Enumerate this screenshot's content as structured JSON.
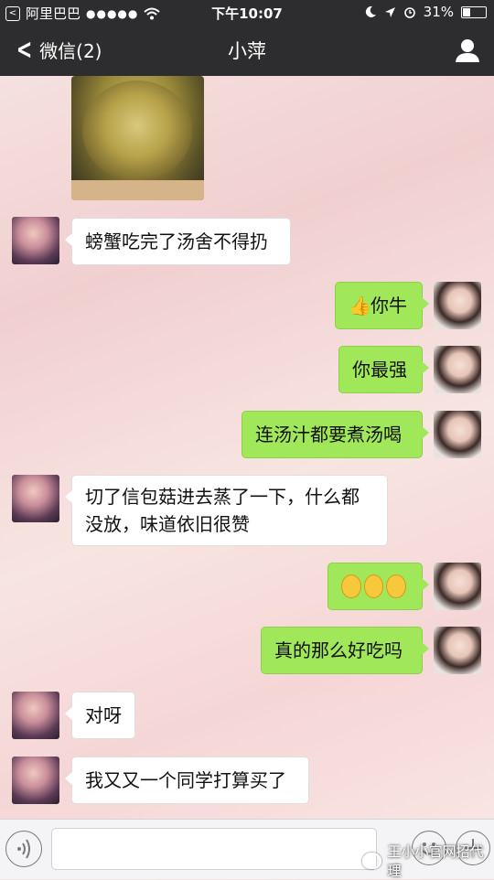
{
  "status_bar": {
    "carrier": "阿里巴巴",
    "signal_dots": "●●●●●",
    "time": "下午10:07",
    "battery_percent": "31%",
    "battery_level": 0.31
  },
  "nav": {
    "back_label": "微信(2)",
    "title": "小萍"
  },
  "messages": [
    {
      "side": "left",
      "text": "螃蟹吃完了汤舍不得扔"
    },
    {
      "side": "right",
      "text": "你牛"
    },
    {
      "side": "right",
      "text": "你最强"
    },
    {
      "side": "right",
      "text": "连汤汁都要煮汤喝"
    },
    {
      "side": "left",
      "text": "切了信包菇进去蒸了一下，什么都没放，味道依旧很赞"
    },
    {
      "side": "right",
      "text": ""
    },
    {
      "side": "right",
      "text": "真的那么好吃吗"
    },
    {
      "side": "left",
      "text": "对呀"
    },
    {
      "side": "left",
      "text": "我又又一个同学打算买了"
    }
  ],
  "watermark": "王小小官网招代理",
  "icons": {
    "voice": "voice-icon",
    "emoji": "emoji-icon",
    "plus": "plus-icon",
    "user": "user-icon"
  }
}
